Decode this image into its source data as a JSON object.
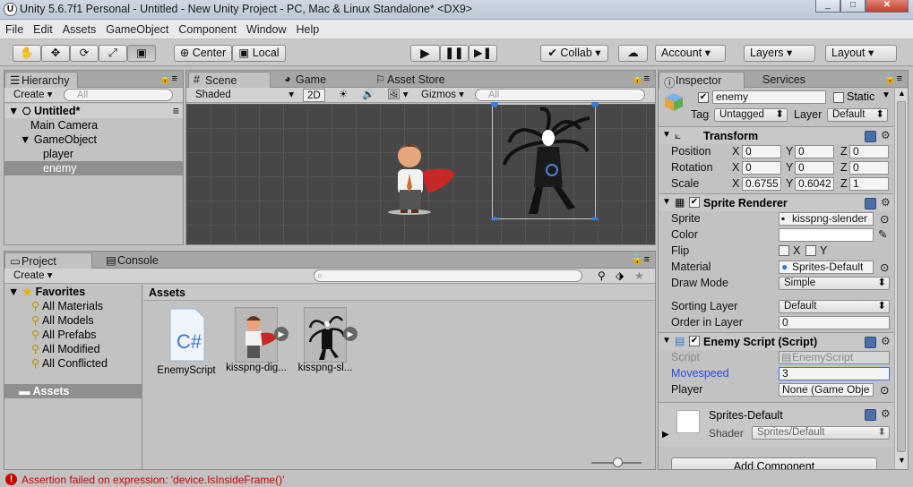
{
  "title": "Unity 5.6.7f1 Personal - Untitled - New Unity Project - PC, Mac & Linux Standalone* <DX9>",
  "menu": [
    "File",
    "Edit",
    "Assets",
    "GameObject",
    "Component",
    "Window",
    "Help"
  ],
  "toolbar": {
    "center": "Center",
    "local": "Local",
    "collab": "Collab",
    "account": "Account",
    "layers": "Layers",
    "layout": "Layout"
  },
  "hierarchy": {
    "tab": "Hierarchy",
    "create": "Create",
    "search": "All",
    "scene": "Untitled*",
    "items": [
      "Main Camera",
      "GameObject",
      "player",
      "enemy"
    ]
  },
  "scene": {
    "tabs": [
      "Scene",
      "Game",
      "Asset Store"
    ],
    "shaded": "Shaded",
    "mode2d": "2D",
    "gizmos": "Gizmos",
    "search": "All"
  },
  "project": {
    "tabs": [
      "Project",
      "Console"
    ],
    "create": "Create",
    "favorites_label": "Favorites",
    "favorites": [
      "All Materials",
      "All Models",
      "All Prefabs",
      "All Modified",
      "All Conflicted"
    ],
    "assets_root": "Assets",
    "assets_header": "Assets",
    "assets": [
      "EnemyScript",
      "kisspng-dig...",
      "kisspng-sl..."
    ]
  },
  "inspector": {
    "tabs": [
      "Inspector",
      "Services"
    ],
    "name": "enemy",
    "static": "Static",
    "tag_label": "Tag",
    "tag": "Untagged",
    "layer_label": "Layer",
    "layer": "Default",
    "transform": {
      "title": "Transform",
      "position": {
        "label": "Position",
        "x": "0",
        "y": "0",
        "z": "0"
      },
      "rotation": {
        "label": "Rotation",
        "x": "0",
        "y": "0",
        "z": "0"
      },
      "scale": {
        "label": "Scale",
        "x": "0.6755",
        "y": "0.6042",
        "z": "1"
      }
    },
    "sprite_renderer": {
      "title": "Sprite Renderer",
      "sprite_label": "Sprite",
      "sprite": "kisspng-slender",
      "color_label": "Color",
      "flip_label": "Flip",
      "flip_x": "X",
      "flip_y": "Y",
      "material_label": "Material",
      "material": "Sprites-Default",
      "draw_mode_label": "Draw Mode",
      "draw_mode": "Simple",
      "sorting_layer_label": "Sorting Layer",
      "sorting_layer": "Default",
      "order_label": "Order in Layer",
      "order": "0"
    },
    "enemy_script": {
      "title": "Enemy Script (Script)",
      "script_label": "Script",
      "script": "EnemyScript",
      "movespeed_label": "Movespeed",
      "movespeed": "3",
      "player_label": "Player",
      "player": "None (Game Obje"
    },
    "material": {
      "name": "Sprites-Default",
      "shader_label": "Shader",
      "shader": "Sprites/Default"
    },
    "add_component": "Add Component"
  },
  "status": "Assertion failed on expression: 'device.IsInsideFrame()'",
  "colors": {
    "selection": "#8f8f8f",
    "link_blue": "#2a4dd6",
    "error_red": "#cc0000",
    "scene_bg": "#474747"
  }
}
